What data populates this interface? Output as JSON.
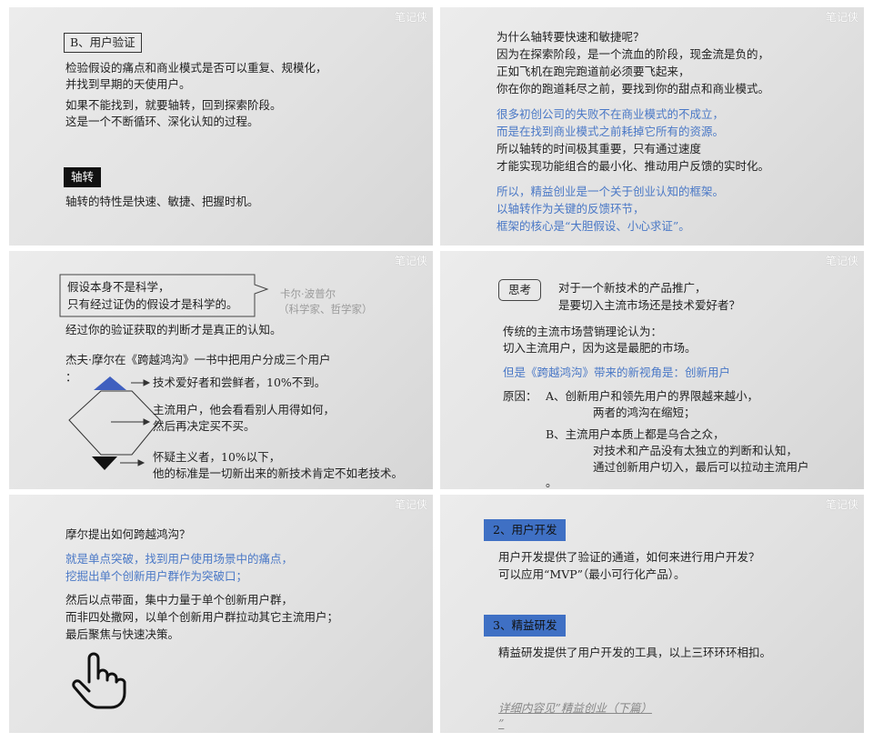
{
  "watermark": "笔记侠",
  "s1": {
    "label": "B、用户验证",
    "p1": [
      "检验假设的痛点和商业模式是否可以重复、规模化，",
      "并找到早期的天使用户。"
    ],
    "p2": [
      "如果不能找到，就要轴转，回到探索阶段。",
      "这是一个不断循环、深化认知的过程。"
    ],
    "label2": "轴转",
    "p3": "轴转的特性是快速、敏捷、把握时机。"
  },
  "s2": {
    "p1": [
      "为什么轴转要快速和敏捷呢？",
      "因为在探索阶段，是一个流血的阶段，现金流是负的，",
      "正如飞机在跑完跑道前必须要飞起来，",
      "你在你的跑道耗尽之前，要找到你的甜点和商业模式。"
    ],
    "p2": [
      "很多初创公司的失败不在商业模式的不成立，",
      "而是在找到商业模式之前耗掉它所有的资源。"
    ],
    "p3": [
      "所以轴转的时间极其重要，只有通过速度",
      "才能实现功能组合的最小化、推动用户反馈的实时化。"
    ],
    "p4": [
      "所以，精益创业是一个关于创业认知的框架。",
      "以轴转作为关键的反馈环节，",
      "框架的核心是“大胆假设、小心求证”。"
    ]
  },
  "s3": {
    "quote": [
      "假设本身不是科学，",
      "只有经过证伪的假设才是科学的。"
    ],
    "author": [
      "卡尔·波普尔",
      "（科学家、哲学家）"
    ],
    "p1": "经过你的验证获取的判断才是真正的认知。",
    "p2": "杰夫·摩尔在《跨越鸿沟》一书中把用户分成三个用户",
    "colon": "：",
    "top": "技术爱好者和尝鲜者，10%不到。",
    "mid": [
      "主流用户，他会看看别人用得如何，",
      "然后再决定买不买。"
    ],
    "bot": [
      "怀疑主义者，10%以下，",
      "他的标准是一切新出来的新技术肯定不如老技术。"
    ]
  },
  "s4": {
    "think": "思考",
    "q": [
      "对于一个新技术的产品推广，",
      "是要切入主流市场还是技术爱好者？"
    ],
    "p1": [
      "传统的主流市场营销理论认为：",
      "切入主流用户，因为这是最肥的市场。"
    ],
    "p2": "但是《跨越鸿沟》带来的新视角是：创新用户",
    "reason": "原因：",
    "a": "A、创新用户和领先用户的界限越来越小，",
    "a2": "两者的鸿沟在缩短；",
    "b": "B、主流用户本质上都是乌合之众，",
    "b2": "对技术和产品没有太独立的判断和认知，",
    "b3": "通过创新用户切入，最后可以拉动主流用户",
    "b4": "。"
  },
  "s5": {
    "p1": "摩尔提出如何跨越鸿沟？",
    "p2": [
      "就是单点突破，找到用户使用场景中的痛点，",
      "挖掘出单个创新用户群作为突破口；"
    ],
    "p3": [
      "然后以点带面，集中力量于单个创新用户群，",
      "而非四处撒网，以单个创新用户群拉动其它主流用户；",
      "最后聚焦与快速决策。"
    ]
  },
  "s6": {
    "label1": "2、用户开发",
    "p1": [
      "用户开发提供了验证的通道，如何来进行用户开发？",
      "可以应用“MVP”（最小可行化产品）。"
    ],
    "label2": "3、精益研发",
    "p2": "精益研发提供了用户开发的工具，以上三环环环相扣。",
    "link": "详细内容见”精益创业（下篇）",
    "link2": "”"
  },
  "colors": {
    "blue_text": "#4a78c6",
    "blue_label": "#3f70c4",
    "dark_label": "#111111"
  },
  "icons": [
    "triangle-up-icon",
    "triangle-down-icon",
    "hexagon-icon",
    "arrow-icon",
    "hand-pointer-icon"
  ]
}
